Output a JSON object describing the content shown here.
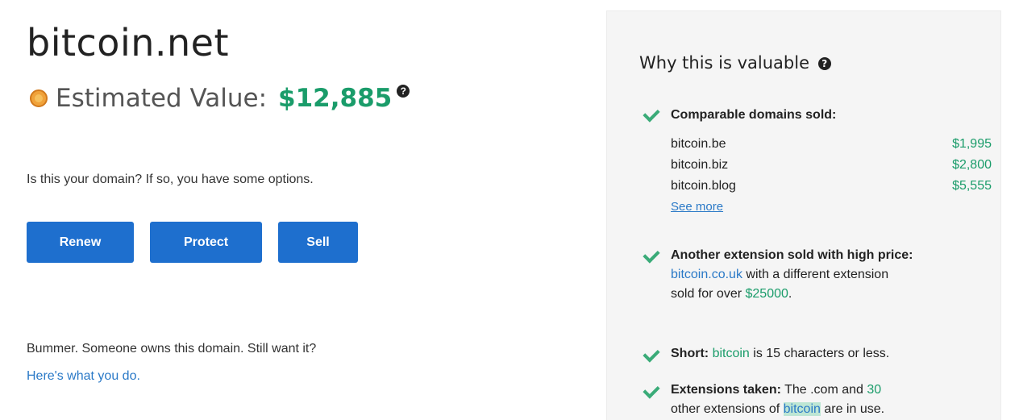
{
  "domain": "bitcoin.net",
  "estimate": {
    "label": "Estimated Value:",
    "value": "$12,885",
    "help": "?"
  },
  "question": "Is this your domain? If so, you have some options.",
  "buttons": {
    "renew": "Renew",
    "protect": "Protect",
    "sell": "Sell"
  },
  "bummer": "Bummer. Someone owns this domain. Still want it?",
  "here_link": "Here's what you do.",
  "panel": {
    "title": "Why this is valuable",
    "help": "?",
    "comparable": {
      "label": "Comparable domains sold:",
      "items": [
        {
          "domain": "bitcoin.be",
          "price": "$1,995"
        },
        {
          "domain": "bitcoin.biz",
          "price": "$2,800"
        },
        {
          "domain": "bitcoin.blog",
          "price": "$5,555"
        }
      ],
      "see_more": "See more"
    },
    "extension": {
      "label": "Another extension sold with high price:",
      "domain": "bitcoin.co.uk",
      "middle": "with a different extension",
      "sold_for": "sold for over",
      "price": "$25000",
      "end": "."
    },
    "short": {
      "label": "Short:",
      "word": "bitcoin",
      "rest": "is 15 characters or less."
    },
    "taken": {
      "label": "Extensions taken:",
      "text1": "The .com and",
      "count": "30",
      "text2": "other extensions of",
      "word": "bitcoin",
      "text3": "are in use."
    }
  },
  "colors": {
    "accent": "#1e6fce",
    "value_green": "#1a9c6a",
    "link_blue": "#2a79c7",
    "check_green": "#3aab78",
    "coin": "#f0a23a"
  }
}
